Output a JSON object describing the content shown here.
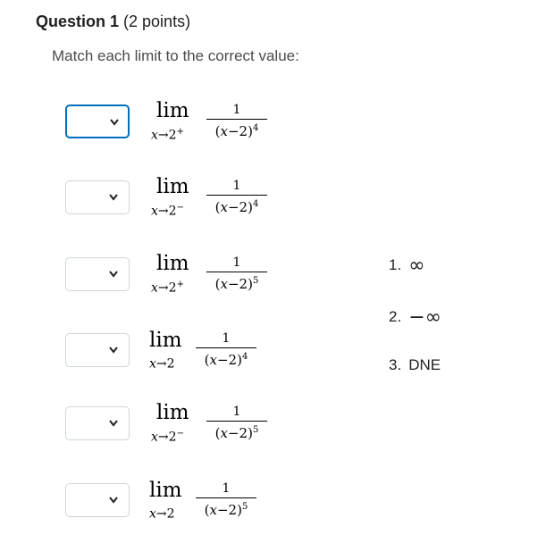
{
  "question": {
    "title": "Question 1",
    "points": "(2 points)",
    "prompt": "Match each limit to the correct value:"
  },
  "limits": [
    {
      "lim": "lim",
      "var": "x",
      "arrow": "→",
      "point": "2",
      "side": "+",
      "num": "1",
      "base": "(x−2)",
      "exp": "4",
      "selected": ""
    },
    {
      "lim": "lim",
      "var": "x",
      "arrow": "→",
      "point": "2",
      "side": "−",
      "num": "1",
      "base": "(x−2)",
      "exp": "4",
      "selected": ""
    },
    {
      "lim": "lim",
      "var": "x",
      "arrow": "→",
      "point": "2",
      "side": "+",
      "num": "1",
      "base": "(x−2)",
      "exp": "5",
      "selected": ""
    },
    {
      "lim": "lim",
      "var": "x",
      "arrow": "→",
      "point": "2",
      "side": "",
      "num": "1",
      "base": "(x−2)",
      "exp": "4",
      "selected": ""
    },
    {
      "lim": "lim",
      "var": "x",
      "arrow": "→",
      "point": "2",
      "side": "−",
      "num": "1",
      "base": "(x−2)",
      "exp": "5",
      "selected": ""
    },
    {
      "lim": "lim",
      "var": "x",
      "arrow": "→",
      "point": "2",
      "side": "",
      "num": "1",
      "base": "(x−2)",
      "exp": "5",
      "selected": ""
    }
  ],
  "answers": [
    {
      "index": "1.",
      "value": "∞"
    },
    {
      "index": "2.",
      "value": "−∞"
    },
    {
      "index": "3.",
      "value": "DNE"
    }
  ],
  "colors": {
    "focus_border": "#006fbf",
    "border": "#cdd5dc",
    "text": "#494c4e"
  },
  "icons": {
    "dropdown": "chevron-down-icon"
  }
}
